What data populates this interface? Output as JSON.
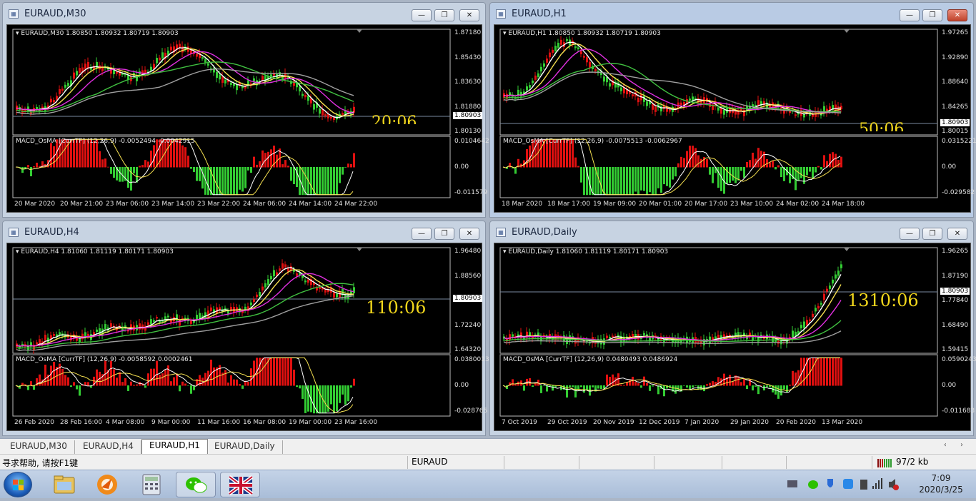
{
  "windows": [
    {
      "id": "m30",
      "title": "EURAUD,M30",
      "legend": "EURAUD,M30  1.80850 1.80932 1.80719 1.80903",
      "macd_legend": "MACD_OsMA [CurrTF] (12,26,9) -0.0052494 -0.0042915",
      "price_ticks": [
        "1.87180",
        "1.85430",
        "1.83630",
        "1.81880",
        "1.80130"
      ],
      "current_price": "1.80903",
      "macd_ticks": [
        "0.0104642",
        "0.00",
        "-0.011579"
      ],
      "time_ticks": [
        "20 Mar 2020",
        "20 Mar 21:00",
        "23 Mar 06:00",
        "23 Mar 14:00",
        "23 Mar 22:00",
        "24 Mar 06:00",
        "24 Mar 14:00",
        "24 Mar 22:00"
      ],
      "timer": "20:06",
      "active": false
    },
    {
      "id": "h1",
      "title": "EURAUD,H1",
      "legend": "EURAUD,H1  1.80850 1.80932 1.80719 1.80903",
      "macd_legend": "MACD_OsMA [CurrTF] (12,26,9) -0.0075513 -0.0062967",
      "price_ticks": [
        "1.97265",
        "1.92890",
        "1.88640",
        "1.84265",
        "1.80015"
      ],
      "current_price": "1.80903",
      "macd_ticks": [
        "0.0315221",
        "0.00",
        "-0.029582"
      ],
      "time_ticks": [
        "18 Mar 2020",
        "18 Mar 17:00",
        "19 Mar 09:00",
        "20 Mar 01:00",
        "20 Mar 17:00",
        "23 Mar 10:00",
        "24 Mar 02:00",
        "24 Mar 18:00"
      ],
      "timer": "50:06",
      "active": true
    },
    {
      "id": "h4",
      "title": "EURAUD,H4",
      "legend": "EURAUD,H4  1.81060 1.81119 1.80171 1.80903",
      "macd_legend": "MACD_OsMA [CurrTF] (12,26,9) -0.0058592 0.0002461",
      "price_ticks": [
        "1.96480",
        "1.88560",
        "1.80903",
        "1.72240",
        "1.64320"
      ],
      "current_price": "1.80903",
      "macd_ticks": [
        "0.0380013",
        "0.00",
        "-0.028765"
      ],
      "time_ticks": [
        "26 Feb 2020",
        "28 Feb 16:00",
        "4 Mar 08:00",
        "9 Mar 00:00",
        "11 Mar 16:00",
        "16 Mar 08:00",
        "19 Mar 00:00",
        "23 Mar 16:00"
      ],
      "timer": "110:06",
      "active": false
    },
    {
      "id": "daily",
      "title": "EURAUD,Daily",
      "legend": "EURAUD,Daily  1.81060 1.81119 1.80171 1.80903",
      "macd_legend": "MACD_OsMA [CurrTF] (12,26,9) 0.0480493 0.0486924",
      "price_ticks": [
        "1.96265",
        "1.87190",
        "1.77840",
        "1.68490",
        "1.59415"
      ],
      "current_price": "1.80903",
      "macd_ticks": [
        "0.0590243",
        "0.00",
        "-0.011683"
      ],
      "time_ticks": [
        "7 Oct 2019",
        "29 Oct 2019",
        "20 Nov 2019",
        "12 Dec 2019",
        "7 Jan 2020",
        "29 Jan 2020",
        "20 Feb 2020",
        "13 Mar 2020"
      ],
      "timer": "1310:06",
      "active": false
    }
  ],
  "window_buttons": {
    "minimize": "—",
    "restore": "❐",
    "close": "✕"
  },
  "tabs": [
    "EURAUD,M30",
    "EURAUD,H4",
    "EURAUD,H1",
    "EURAUD,Daily"
  ],
  "active_tab": "EURAUD,H1",
  "tab_arrows": "‹ ›",
  "status": {
    "help": "寻求帮助, 请按F1键",
    "symbol": "EURAUD",
    "traffic": "97/2 kb"
  },
  "taskbar": {
    "time": "7:09",
    "date": "2020/3/25",
    "apps": [
      "file-explorer",
      "browser",
      "calculator",
      "wechat",
      "uk-flag-app"
    ]
  },
  "colors": {
    "chart_bg": "#000000",
    "bull": "#33cc33",
    "bear": "#e01010",
    "ma_fast": "#ffffff",
    "ma_yellow": "#f5e050",
    "ma_magenta": "#e030e0",
    "ma_green": "#40c040",
    "ma_gray": "#a0a0a0",
    "timer": "#f2d71c"
  }
}
